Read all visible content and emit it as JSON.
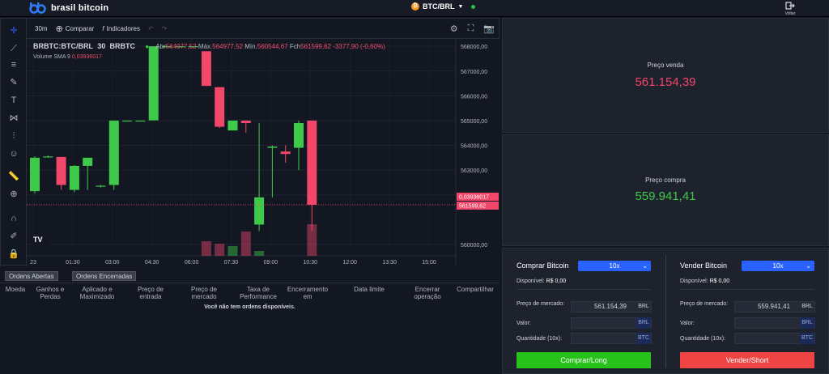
{
  "header": {
    "brand": "brasil bitcoin",
    "pair": "BTC/BRL",
    "coin_symbol": "₿",
    "back_label": "Voltar"
  },
  "toolbar": {
    "interval": "30m",
    "compare": "Comparar",
    "indicators": "Indicadores"
  },
  "legend": {
    "symbol": "BRBTC:BTC/BRL",
    "interval": "30",
    "exchange": "BRBTC",
    "open_label": "Abr",
    "open": "564977,52",
    "high_label": "Máx.",
    "high": "564977,52",
    "low_label": "Mín.",
    "low": "560544,67",
    "close_label": "Fch",
    "close": "561599,62",
    "change": "-3377,90 (-0,60%)"
  },
  "volume": {
    "label": "Volume",
    "sma": "SMA 9",
    "value": "0,03936017"
  },
  "price_axis": {
    "ticks": [
      "568000,00",
      "567000,00",
      "566000,00",
      "565000,00",
      "564000,00",
      "563000,00",
      "562000,00",
      "560000,00"
    ],
    "tag_volume": "0,03936017",
    "tag_price": "561599,62"
  },
  "time_axis": {
    "ticks": [
      "23",
      "01:30",
      "03:00",
      "04:30",
      "06:00",
      "07:30",
      "09:00",
      "10:30",
      "12:00",
      "13:30",
      "15:00"
    ]
  },
  "chart_data": {
    "type": "candlestick",
    "x": [
      "23 00:00",
      "00:30",
      "01:00",
      "01:30",
      "02:00",
      "02:30",
      "03:00",
      "03:30",
      "04:00",
      "04:30",
      "05:00",
      "05:30",
      "06:00",
      "06:30",
      "07:00",
      "07:30",
      "08:00",
      "08:30",
      "09:00",
      "09:30",
      "10:00",
      "10:30"
    ],
    "series": [
      {
        "open": [
          562150,
          563550,
          563530,
          562200,
          563170,
          562370,
          562400,
          565000,
          565000,
          565010,
          568000,
          568000,
          568000,
          567800,
          566350,
          564600,
          565000,
          560800,
          563900,
          563750,
          563900,
          565000
        ],
        "close": [
          563500,
          563550,
          562400,
          563170,
          563500,
          562370,
          565000,
          565000,
          565000,
          568000,
          568000,
          568000,
          568000,
          566400,
          564750,
          565000,
          564900,
          561900,
          563950,
          563650,
          564900,
          561599.62
        ],
        "high": [
          563550,
          563600,
          563530,
          563200,
          563500,
          562400,
          565000,
          565010,
          565000,
          568000,
          568010,
          568000,
          568000,
          567800,
          566350,
          565000,
          565000,
          564900,
          564000,
          564000,
          565000,
          565000
        ],
        "low": [
          562050,
          563500,
          562200,
          562100,
          562200,
          562300,
          562200,
          565000,
          565000,
          565000,
          568000,
          568000,
          568000,
          566400,
          564700,
          564600,
          564500,
          560544.67,
          561900,
          563300,
          563000,
          560544.67
        ]
      }
    ],
    "ylim": [
      559800,
      568300
    ]
  },
  "prices": {
    "sell_title": "Preço venda",
    "sell_value": "561.154,39",
    "buy_title": "Preço compra",
    "buy_value": "559.941,41"
  },
  "orders": {
    "tab_open": "Ordens Abertas",
    "tab_closed": "Ordens Encerradas",
    "headers": [
      "Moeda",
      "Ganhos e Perdas",
      "Aplicado e Maximizado",
      "Preço de entrada",
      "Preço de mercado",
      "Taxa de Performance",
      "Encerramento em",
      "Data limite",
      "Encerrar operação",
      "Compartilhar"
    ],
    "empty": "Você não tem ordens disponíveis."
  },
  "buy": {
    "title": "Comprar Bitcoin",
    "leverage": "10x",
    "available_label": "Disponível:",
    "available": "R$ 0,00",
    "market_label": "Preço de mercado:",
    "market_value": "561.154,39",
    "value_label": "Valor:",
    "qty_label": "Quantidade (10x):",
    "unit_brl": "BRL",
    "unit_btc": "BTC",
    "button": "Comprar/Long",
    "button_color": "#27c11b"
  },
  "sell": {
    "title": "Vender Bitcoin",
    "leverage": "10x",
    "available_label": "Disponível:",
    "available": "R$ 0,00",
    "market_label": "Preço de mercado:",
    "market_value": "559.941,41",
    "value_label": "Valor:",
    "qty_label": "Quantidade (10x):",
    "unit_brl": "BRL",
    "unit_btc": "BTC",
    "button": "Vender/Short",
    "button_color": "#ef4444"
  },
  "colors": {
    "up": "#3ec94a",
    "down": "#f0476a",
    "accent": "#2962ff"
  }
}
